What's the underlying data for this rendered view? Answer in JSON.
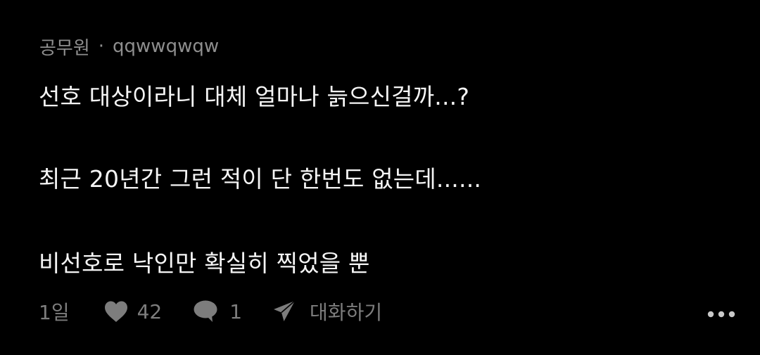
{
  "comment": {
    "author": "공무원",
    "separator": "·",
    "username": "qqwwqwqw",
    "lines": [
      "선호 대상이라니 대체 얼마나 늙으신걸까...?",
      "최근 20년간 그런 적이 단 한번도 없는데......",
      "비선호로 낙인만 확실히 찍었을 뿐"
    ]
  },
  "actions": {
    "time": "1일",
    "likes": "42",
    "replies": "1",
    "chat_label": "대화하기",
    "icons": {
      "like": "heart-icon",
      "reply": "speech-bubble-icon",
      "chat": "paper-plane-icon",
      "more": "more-dots-icon"
    }
  },
  "colors": {
    "background": "#000000",
    "text_primary": "#f5f5f5",
    "text_meta": "#8e8e8e",
    "text_action": "#7d7d7d"
  }
}
